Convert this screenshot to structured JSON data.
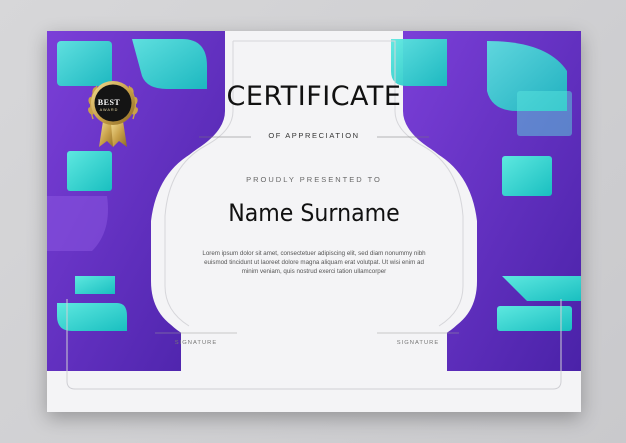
{
  "certificate": {
    "title": "CERTIFICATE",
    "subtitle": "OF APPRECIATION",
    "presented": "PROUDLY PRESENTED TO",
    "name": "Name Surname",
    "body_line1": "Lorem ipsum dolor sit amet, consectetuer adipiscing elit, sed diam nonummy nibh",
    "body_line2": "euismod tincidunt ut laoreet dolore magna aliquam erat volutpat. Ut wisi enim ad",
    "body_line3": "minim veniam, quis nostrud exerci tation ullamcorper",
    "signature_left": "SIGNATURE",
    "signature_right": "SIGNATURE"
  },
  "badge": {
    "main": "BEST",
    "sub": "AWARD"
  },
  "colors": {
    "purple": "#6b2fc4",
    "purple_dark": "#4a1f9a",
    "teal": "#2ad6cf",
    "gold": "#c9a24a",
    "paper": "#f4f4f6"
  }
}
